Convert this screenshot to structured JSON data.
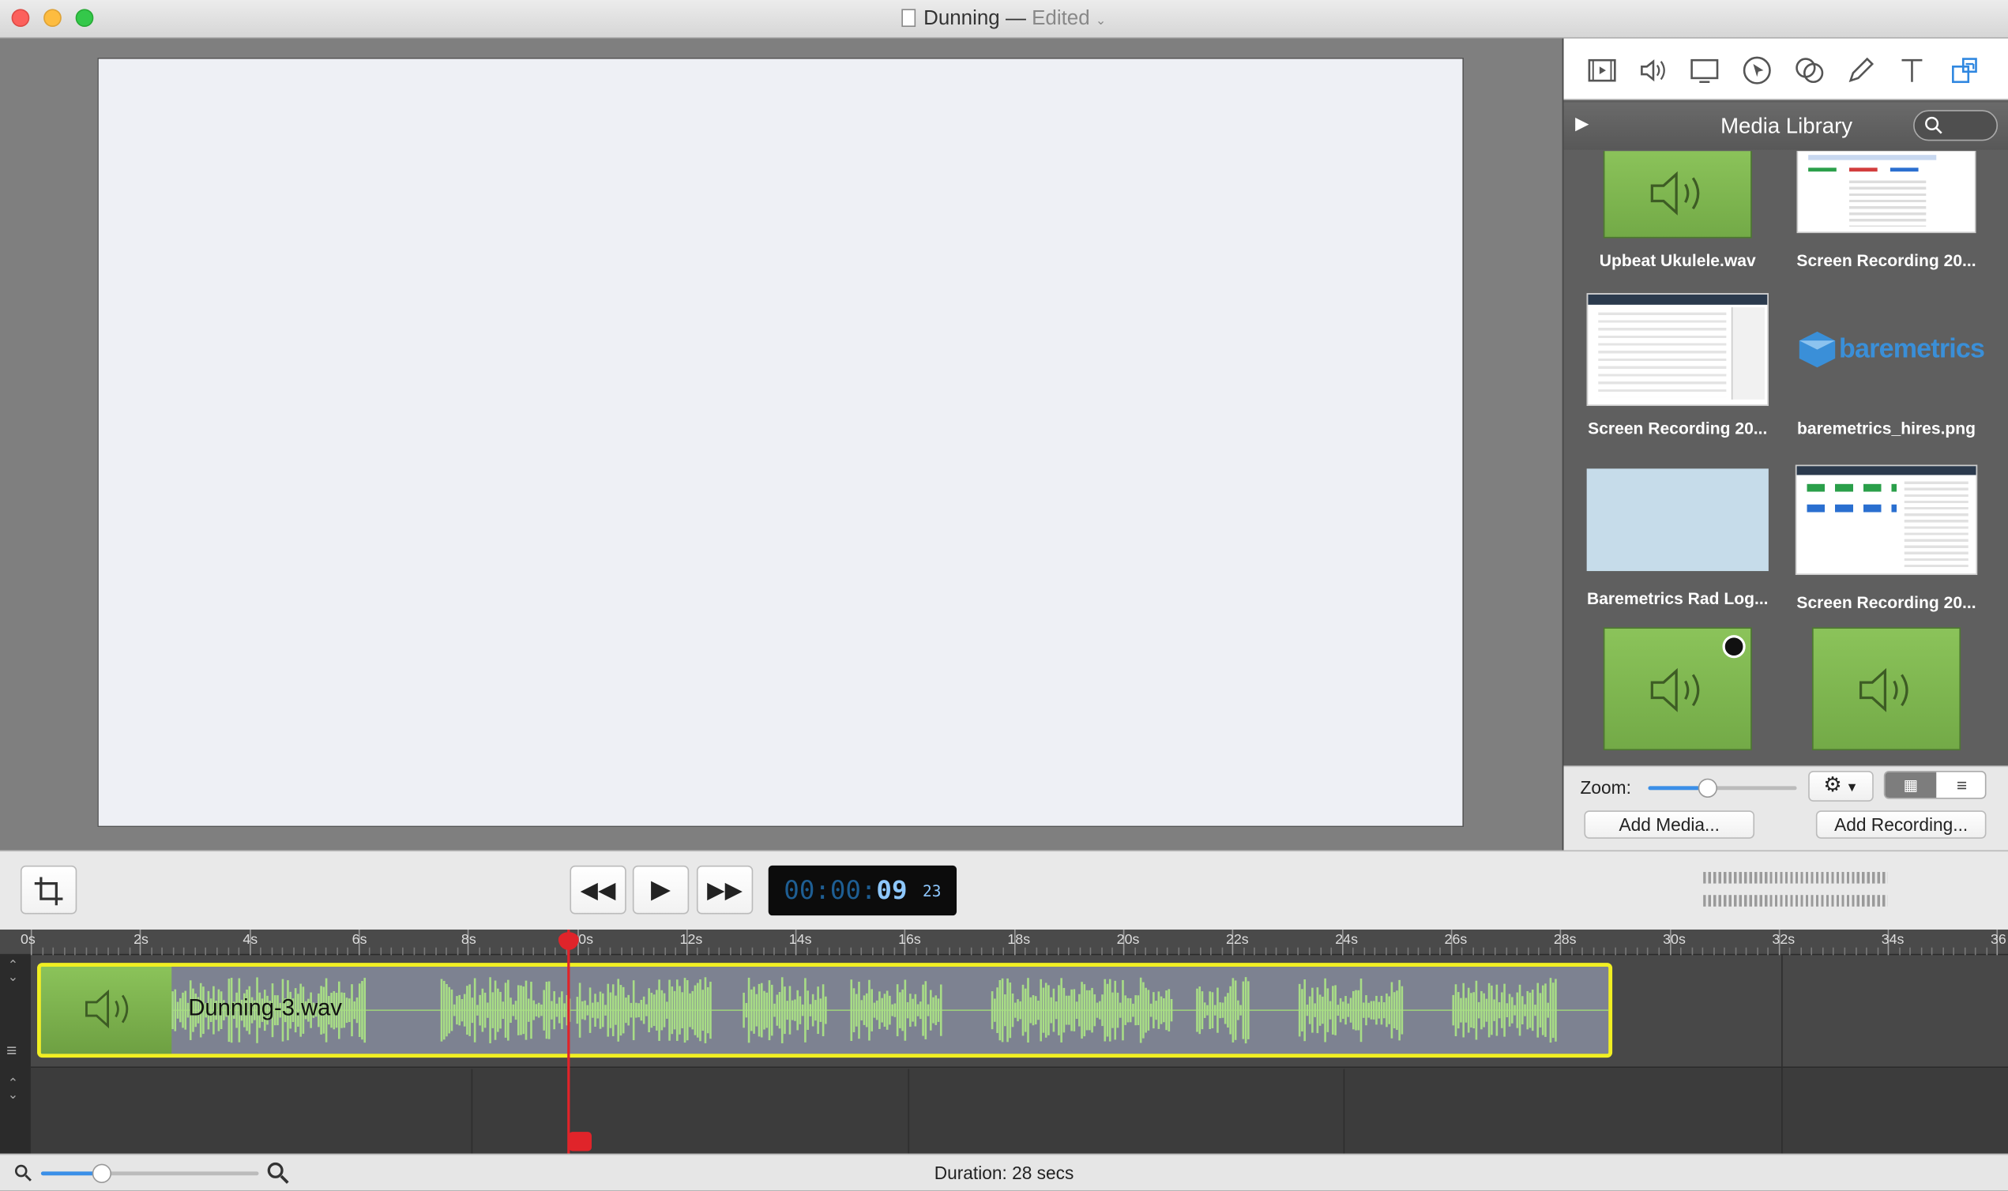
{
  "window": {
    "title": "Dunning",
    "separator": "—",
    "status": "Edited"
  },
  "toolbar": {
    "tools": [
      "video-icon",
      "audio-icon",
      "screen-icon",
      "cursor-icon",
      "annotations-icon",
      "pen-icon",
      "text-icon",
      "media-library-icon"
    ]
  },
  "library": {
    "title": "Media Library",
    "items": [
      {
        "label": "Upbeat Ukulele.wav",
        "kind": "audio"
      },
      {
        "label": "Screen Recording 20...",
        "kind": "screen"
      },
      {
        "label": "Screen Recording 20...",
        "kind": "screen"
      },
      {
        "label": "baremetrics_hires.png",
        "kind": "logo",
        "logo_text": "baremetrics"
      },
      {
        "label": "Baremetrics Rad Log...",
        "kind": "blank"
      },
      {
        "label": "Screen Recording 20...",
        "kind": "screen"
      },
      {
        "label": "",
        "kind": "audio"
      },
      {
        "label": "",
        "kind": "audio"
      }
    ],
    "zoom_label": "Zoom:",
    "zoom_level": 0.4,
    "add_media": "Add Media...",
    "add_recording": "Add Recording..."
  },
  "playback": {
    "timecode_main": "00:00:",
    "timecode_sec": "09",
    "timecode_frames": "23"
  },
  "timeline": {
    "ticks": [
      "0s",
      "2s",
      "4s",
      "6s",
      "8s",
      "10s",
      "12s",
      "14s",
      "16s",
      "18s",
      "20s",
      "22s",
      "24s",
      "26s",
      "28s",
      "30s",
      "32s",
      "34s",
      "36"
    ],
    "clip_name": "Dunning-3.wav",
    "playhead_seconds": 9.77
  },
  "status": {
    "duration": "Duration: 28 secs"
  },
  "colors": {
    "accent": "#f1ef22",
    "playhead": "#e0242a",
    "timecode": "#3aa6ff",
    "audio_green": "#8bc35a"
  }
}
